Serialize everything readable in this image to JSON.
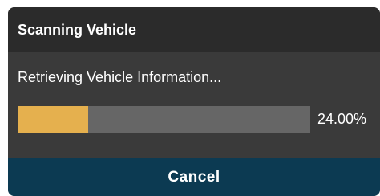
{
  "dialog": {
    "title": "Scanning Vehicle",
    "status_text": "Retrieving Vehicle Information...",
    "progress": {
      "value": 24.0,
      "label": "24.00%"
    },
    "cancel_label": "Cancel"
  },
  "colors": {
    "header_bg": "#2b2b2b",
    "body_bg": "#3a3a3a",
    "progress_track": "#666666",
    "progress_fill": "#e5b04e",
    "footer_bg": "#0c3a52",
    "text": "#ffffff"
  }
}
